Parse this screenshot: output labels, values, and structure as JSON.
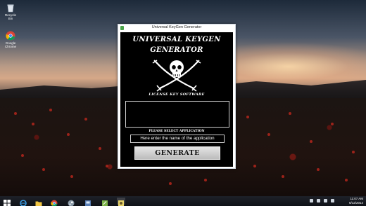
{
  "desktop": {
    "icons": [
      {
        "name": "recycle-bin",
        "label": "Recycle Bin"
      },
      {
        "name": "chrome",
        "label": "Google Chrome"
      }
    ]
  },
  "window": {
    "title": "Universal KeyGen Generator",
    "heading_line1": "UNIVERSAL KEYGEN",
    "heading_line2": "GENERATOR",
    "subheading": "LICENSE KEY SOFTWARE",
    "key_output": "",
    "select_label": "PLEASE SELECT APPLICATION",
    "app_input_value": "Here enter the name of the application",
    "generate_label": "GENERATE"
  },
  "taskbar": {
    "apps": [
      "start",
      "ie",
      "explorer",
      "chrome",
      "steam",
      "network",
      "notepad",
      "keygen"
    ],
    "time": "11:07 AM",
    "date": "6/12/2014"
  },
  "colors": {
    "window_bg": "#000000",
    "button_bg": "#cccccc",
    "text": "#ffffff"
  }
}
